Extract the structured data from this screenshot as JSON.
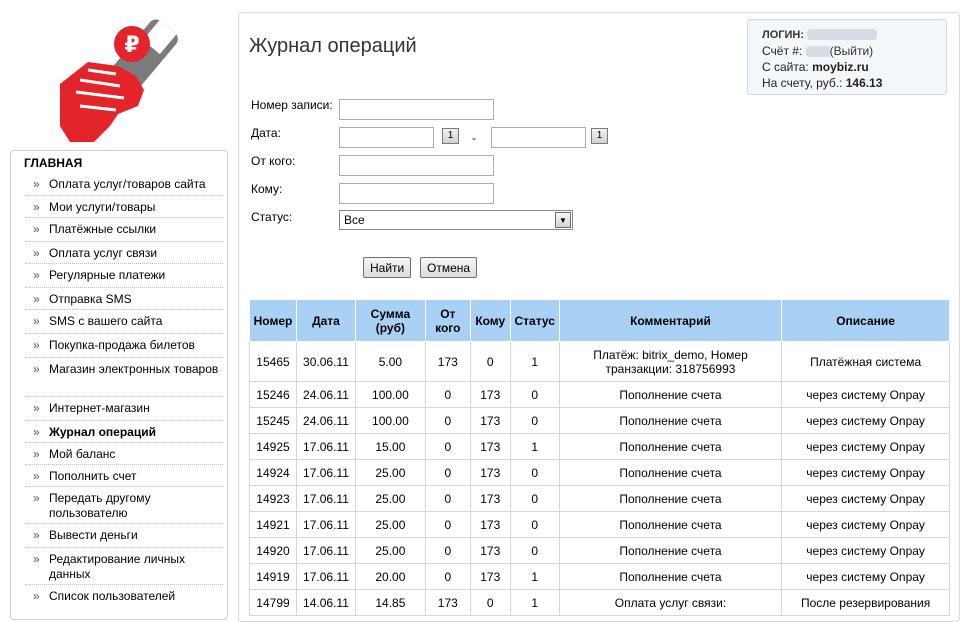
{
  "sidebar": {
    "title": "ГЛАВНАЯ",
    "items": [
      {
        "label": "Оплата услуг/товаров сайта",
        "active": false
      },
      {
        "label": "Мои услуги/товары",
        "active": false
      },
      {
        "label": "Платёжные ссылки",
        "active": false
      },
      {
        "label": "Оплата услуг связи",
        "active": false
      },
      {
        "label": "Регулярные платежи",
        "active": false
      },
      {
        "label": "Отправка SMS",
        "active": false
      },
      {
        "label": "SMS с вашего сайта",
        "active": false
      },
      {
        "label": "Покупка-продажа билетов",
        "active": false
      },
      {
        "label": "Магазин электронных товаров",
        "active": false
      },
      {
        "label": "Интернет-магазин",
        "active": false
      },
      {
        "label": "Журнал операций",
        "active": true
      },
      {
        "label": "Мой баланс",
        "active": false
      },
      {
        "label": "Пополнить счет",
        "active": false
      },
      {
        "label": "Передать другому пользователю",
        "active": false
      },
      {
        "label": "Вывести деньги",
        "active": false
      },
      {
        "label": "Редактирование личных данных",
        "active": false
      },
      {
        "label": "Список пользователей",
        "active": false
      }
    ]
  },
  "page": {
    "title": "Журнал операций"
  },
  "account": {
    "login_label": "ЛОГИН:",
    "account_label": "Счёт #:",
    "logout": "(Выйти)",
    "site_label": "С сайта:",
    "site": "moybiz.ru",
    "balance_label": "На счету, руб.:",
    "balance": "146.13"
  },
  "filter": {
    "record_label": "Номер записи:",
    "record_value": "",
    "date_label": "Дата:",
    "date_from": "",
    "date_to": "",
    "date_separator": "-",
    "calendar_icon_text": "1",
    "from_label": "От кого:",
    "from_value": "",
    "to_label": "Кому:",
    "to_value": "",
    "status_label": "Статус:",
    "status_value": "Все",
    "find_button": "Найти",
    "cancel_button": "Отмена"
  },
  "table": {
    "headers": [
      "Номер",
      "Дата",
      "Сумма (руб)",
      "От кого",
      "Кому",
      "Статус",
      "Комментарий",
      "Описание"
    ],
    "rows": [
      [
        "15465",
        "30.06.11",
        "5.00",
        "173",
        "0",
        "1",
        "Платёж: bitrix_demo, Номер транзакции: 318756993",
        "Платёжная система"
      ],
      [
        "15246",
        "24.06.11",
        "100.00",
        "0",
        "173",
        "0",
        "Пополнение счета",
        "через систему Onpay"
      ],
      [
        "15245",
        "24.06.11",
        "100.00",
        "0",
        "173",
        "0",
        "Пополнение счета",
        "через систему Onpay"
      ],
      [
        "14925",
        "17.06.11",
        "15.00",
        "0",
        "173",
        "1",
        "Пополнение счета",
        "через систему Onpay"
      ],
      [
        "14924",
        "17.06.11",
        "25.00",
        "0",
        "173",
        "0",
        "Пополнение счета",
        "через систему Onpay"
      ],
      [
        "14923",
        "17.06.11",
        "25.00",
        "0",
        "173",
        "0",
        "Пополнение счета",
        "через систему Onpay"
      ],
      [
        "14921",
        "17.06.11",
        "25.00",
        "0",
        "173",
        "0",
        "Пополнение счета",
        "через систему Onpay"
      ],
      [
        "14920",
        "17.06.11",
        "25.00",
        "0",
        "173",
        "0",
        "Пополнение счета",
        "через систему Onpay"
      ],
      [
        "14919",
        "17.06.11",
        "20.00",
        "0",
        "173",
        "1",
        "Пополнение счета",
        "через систему Onpay"
      ],
      [
        "14799",
        "14.06.11",
        "14.85",
        "173",
        "0",
        "1",
        "Оплата услуг связи:",
        "После резервирования"
      ]
    ]
  },
  "colors": {
    "table_header": "#a8d1f5",
    "logo_red": "#e3242b",
    "logo_gray": "#7b7b7b"
  }
}
